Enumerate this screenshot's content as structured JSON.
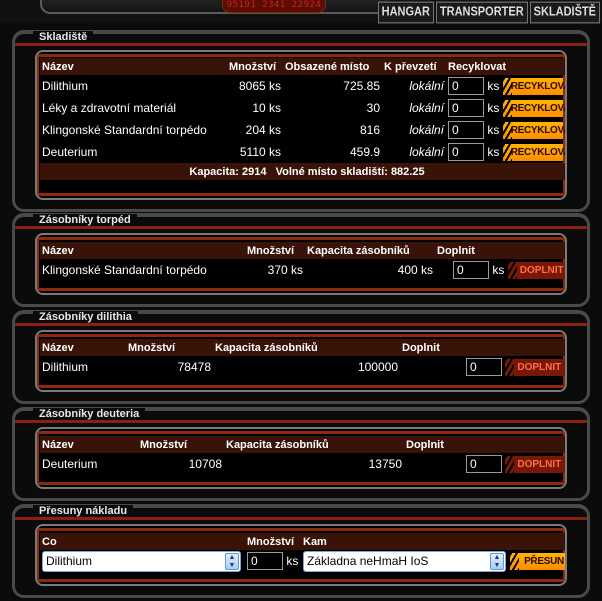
{
  "top": {
    "display": "95191 2341 22924",
    "nav": [
      "HANGAR",
      "TRANSPORTER",
      "SKLADIŠTĚ"
    ]
  },
  "storage": {
    "title": "Skladiště",
    "headers": [
      "Název",
      "Množství",
      "Obsazené místo",
      "K převzetí",
      "Recyklovat"
    ],
    "rows": [
      {
        "name": "Dilithium",
        "qty": "8065 ks",
        "space": "725.85",
        "pickup": "lokální",
        "input": "0",
        "unit": "ks",
        "button": "RECYKLOVAT"
      },
      {
        "name": "Léky a zdravotní materiál",
        "qty": "10 ks",
        "space": "30",
        "pickup": "lokální",
        "input": "0",
        "unit": "ks",
        "button": "RECYKLOVAT"
      },
      {
        "name": "Klingonské Standardní torpédo",
        "qty": "204 ks",
        "space": "816",
        "pickup": "lokální",
        "input": "0",
        "unit": "ks",
        "button": "RECYKLOVAT"
      },
      {
        "name": "Deuterium",
        "qty": "5110 ks",
        "space": "459.9",
        "pickup": "lokální",
        "input": "0",
        "unit": "ks",
        "button": "RECYKLOVAT"
      }
    ],
    "summary": "Kapacita: 2914   Volné místo skladiští: 882.25"
  },
  "torpedo": {
    "title": "Zásobníky torpéd",
    "headers": [
      "Název",
      "Množství",
      "Kapacita zásobníků",
      "Doplnit"
    ],
    "row": {
      "name": "Klingonské Standardní torpédo",
      "qty": "370 ks",
      "capacity": "400 ks",
      "input": "0",
      "unit": "ks",
      "button": "DOPLNIT"
    }
  },
  "dilithium": {
    "title": "Zásobníky dilithia",
    "headers": [
      "Název",
      "Množství",
      "Kapacita zásobníků",
      "Doplnit"
    ],
    "row": {
      "name": "Dilithium",
      "qty": "78478",
      "capacity": "100000",
      "input": "0",
      "button": "DOPLNIT"
    }
  },
  "deuterium": {
    "title": "Zásobníky deuteria",
    "headers": [
      "Název",
      "Množství",
      "Kapacita zásobníků",
      "Doplnit"
    ],
    "row": {
      "name": "Deuterium",
      "qty": "10708",
      "capacity": "13750",
      "input": "0",
      "button": "DOPLNIT"
    }
  },
  "transfer": {
    "title": "Přesuny nákladu",
    "headers": [
      "Co",
      "Množství",
      "Kam"
    ],
    "what": "Dilithium",
    "qty": "0",
    "unit": "ks",
    "where": "Základna neHmaH IoS",
    "button": "PŘESUN"
  },
  "colors": {
    "accent_orange": "#ff9c00",
    "header_bg": "#3a1308",
    "panel_border": "#4a4a4a",
    "frame_red": "#8c2a0e"
  }
}
